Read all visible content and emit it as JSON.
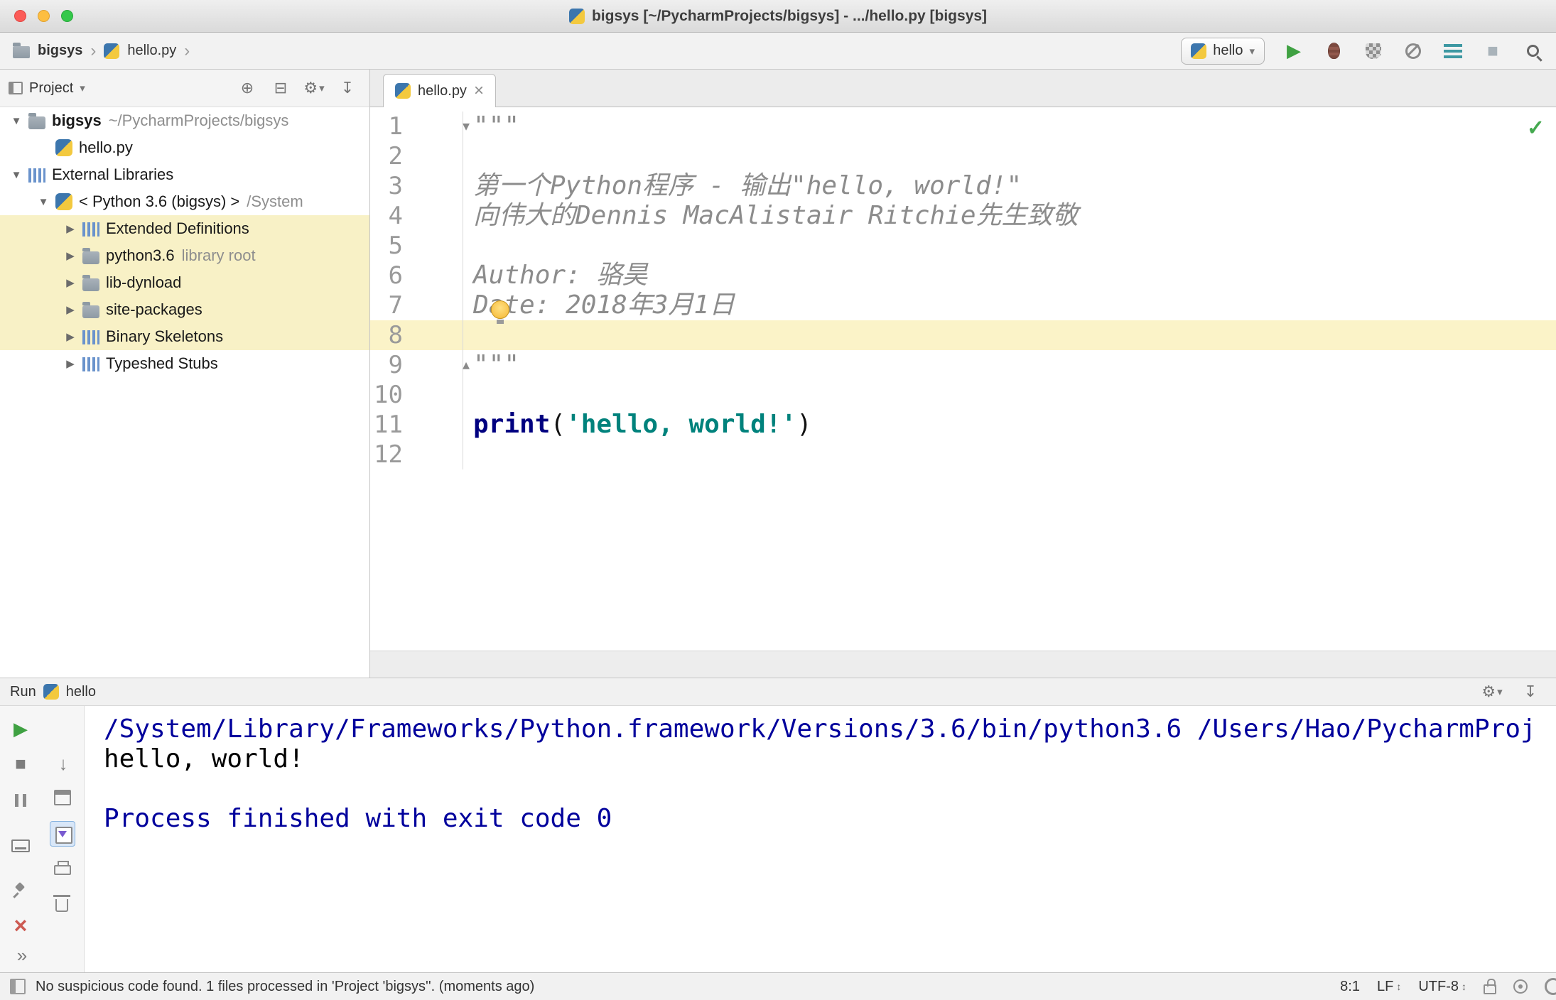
{
  "titlebar": {
    "title": "bigsys [~/PycharmProjects/bigsys] - .../hello.py [bigsys]"
  },
  "navbar": {
    "project_crumb": "bigsys",
    "file_crumb": "hello.py",
    "run_config": "hello"
  },
  "project": {
    "title": "Project",
    "tree": [
      {
        "label": "bigsys",
        "suffix": "~/PycharmProjects/bigsys",
        "icon": "folder",
        "chevron": "down",
        "level": 0,
        "bold": true
      },
      {
        "label": "hello.py",
        "icon": "pyfile",
        "chevron": null,
        "level": 1
      },
      {
        "label": "External Libraries",
        "icon": "libraries",
        "chevron": "down",
        "level": 0
      },
      {
        "label": "< Python 3.6 (bigsys) >",
        "suffix": "/System",
        "icon": "python",
        "chevron": "down",
        "level": 1
      },
      {
        "label": "Extended Definitions",
        "icon": "libraries",
        "chevron": "right",
        "level": 2,
        "highlight": true
      },
      {
        "label": "python3.6",
        "suffix": "library root",
        "icon": "folder",
        "chevron": "right",
        "level": 2,
        "highlight": true
      },
      {
        "label": "lib-dynload",
        "icon": "folder",
        "chevron": "right",
        "level": 2,
        "highlight": true
      },
      {
        "label": "site-packages",
        "icon": "folder",
        "chevron": "right",
        "level": 2,
        "highlight": true
      },
      {
        "label": "Binary Skeletons",
        "icon": "libraries",
        "chevron": "right",
        "level": 2,
        "highlight": true
      },
      {
        "label": "Typeshed Stubs",
        "icon": "libraries",
        "chevron": "right",
        "level": 2
      }
    ]
  },
  "editor": {
    "tab_label": "hello.py",
    "lines": [
      {
        "n": 1,
        "fold": "down",
        "segments": [
          {
            "t": "\"\"\"",
            "c": "doc"
          }
        ]
      },
      {
        "n": 2,
        "segments": []
      },
      {
        "n": 3,
        "segments": [
          {
            "t": "第一个Python程序 - 输出\"hello, world!\"",
            "c": "doc"
          }
        ]
      },
      {
        "n": 4,
        "segments": [
          {
            "t": "向伟大的Dennis MacAlistair Ritchie先生致敬",
            "c": "doc"
          }
        ]
      },
      {
        "n": 5,
        "segments": []
      },
      {
        "n": 6,
        "segments": [
          {
            "t": "Author: 骆昊",
            "c": "doc"
          }
        ]
      },
      {
        "n": 7,
        "segments": [
          {
            "t": "Date: 2018年3月1日",
            "c": "doc"
          }
        ]
      },
      {
        "n": 8,
        "current": true,
        "segments": []
      },
      {
        "n": 9,
        "fold": "up",
        "segments": [
          {
            "t": "\"\"\"",
            "c": "doc"
          }
        ]
      },
      {
        "n": 10,
        "segments": []
      },
      {
        "n": 11,
        "segments": [
          {
            "t": "print",
            "c": "kw"
          },
          {
            "t": "(",
            "c": "pl"
          },
          {
            "t": "'hello, world!'",
            "c": "str"
          },
          {
            "t": ")",
            "c": "pl"
          }
        ]
      },
      {
        "n": 12,
        "segments": []
      }
    ]
  },
  "run": {
    "title": "Run",
    "config": "hello",
    "console": [
      {
        "text": "/System/Library/Frameworks/Python.framework/Versions/3.6/bin/python3.6 /Users/Hao/PycharmProj",
        "kind": "system"
      },
      {
        "text": "hello, world!",
        "kind": "stdout"
      },
      {
        "text": "",
        "kind": "stdout"
      },
      {
        "text": "Process finished with exit code 0",
        "kind": "system"
      }
    ]
  },
  "statusbar": {
    "message": "No suspicious code found. 1 files processed in 'Project 'bigsys''. (moments ago)",
    "caret_position": "8:1",
    "line_separator": "LF",
    "encoding": "UTF-8"
  },
  "icons": {
    "dropdown": "▾",
    "play": "▶",
    "stop": "■",
    "gear": "⚙",
    "target": "⊕",
    "collapse": "⊟",
    "hide": "↧",
    "close": "×",
    "check": "✓",
    "arrow_down": "↓",
    "more": "»",
    "updown": "↕",
    "crumb_sep": "›",
    "tree_expanded": "▼",
    "tree_collapsed": "▶",
    "fold_start": "▾",
    "fold_end": "▴"
  },
  "colors": {
    "accent_green": "#3fa142",
    "current_line": "#fbf3c8",
    "scope_highlight": "#f8f1c6",
    "keyword": "#000080",
    "string": "#00827c",
    "docstring": "#8c8c8c",
    "console_system": "#00009c"
  }
}
